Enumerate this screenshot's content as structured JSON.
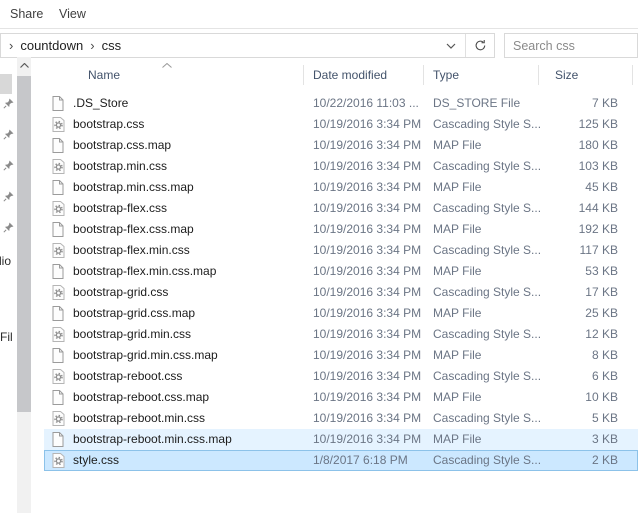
{
  "ribbon": {
    "tabs": [
      {
        "label": "Share"
      },
      {
        "label": "View"
      }
    ]
  },
  "address_bar": {
    "breadcrumb": {
      "separator": "›",
      "items": [
        "countdown",
        "css"
      ]
    },
    "icons": [
      "chevron-down-icon",
      "refresh-icon"
    ]
  },
  "search": {
    "placeholder": "Search css"
  },
  "nav_pane": {
    "pin_icon": "pin-icon",
    "pin_count": 5,
    "clipped_labels": [
      "dio",
      "Fil"
    ]
  },
  "file_list": {
    "columns": [
      {
        "label": "Name",
        "sort": "asc"
      },
      {
        "label": "Date modified"
      },
      {
        "label": "Type"
      },
      {
        "label": "Size"
      }
    ],
    "rows": [
      {
        "name": ".DS_Store",
        "date": "10/22/2016 11:03 ...",
        "type": "DS_STORE File",
        "size": "7 KB",
        "icon": "file",
        "state": "none"
      },
      {
        "name": "bootstrap.css",
        "date": "10/19/2016 3:34 PM",
        "type": "Cascading Style S...",
        "size": "125 KB",
        "icon": "css",
        "state": "none"
      },
      {
        "name": "bootstrap.css.map",
        "date": "10/19/2016 3:34 PM",
        "type": "MAP File",
        "size": "180 KB",
        "icon": "file",
        "state": "none"
      },
      {
        "name": "bootstrap.min.css",
        "date": "10/19/2016 3:34 PM",
        "type": "Cascading Style S...",
        "size": "103 KB",
        "icon": "css",
        "state": "none"
      },
      {
        "name": "bootstrap.min.css.map",
        "date": "10/19/2016 3:34 PM",
        "type": "MAP File",
        "size": "45 KB",
        "icon": "file",
        "state": "none"
      },
      {
        "name": "bootstrap-flex.css",
        "date": "10/19/2016 3:34 PM",
        "type": "Cascading Style S...",
        "size": "144 KB",
        "icon": "css",
        "state": "none"
      },
      {
        "name": "bootstrap-flex.css.map",
        "date": "10/19/2016 3:34 PM",
        "type": "MAP File",
        "size": "192 KB",
        "icon": "file",
        "state": "none"
      },
      {
        "name": "bootstrap-flex.min.css",
        "date": "10/19/2016 3:34 PM",
        "type": "Cascading Style S...",
        "size": "117 KB",
        "icon": "css",
        "state": "none"
      },
      {
        "name": "bootstrap-flex.min.css.map",
        "date": "10/19/2016 3:34 PM",
        "type": "MAP File",
        "size": "53 KB",
        "icon": "file",
        "state": "none"
      },
      {
        "name": "bootstrap-grid.css",
        "date": "10/19/2016 3:34 PM",
        "type": "Cascading Style S...",
        "size": "17 KB",
        "icon": "css",
        "state": "none"
      },
      {
        "name": "bootstrap-grid.css.map",
        "date": "10/19/2016 3:34 PM",
        "type": "MAP File",
        "size": "25 KB",
        "icon": "file",
        "state": "none"
      },
      {
        "name": "bootstrap-grid.min.css",
        "date": "10/19/2016 3:34 PM",
        "type": "Cascading Style S...",
        "size": "12 KB",
        "icon": "css",
        "state": "none"
      },
      {
        "name": "bootstrap-grid.min.css.map",
        "date": "10/19/2016 3:34 PM",
        "type": "MAP File",
        "size": "8 KB",
        "icon": "file",
        "state": "none"
      },
      {
        "name": "bootstrap-reboot.css",
        "date": "10/19/2016 3:34 PM",
        "type": "Cascading Style S...",
        "size": "6 KB",
        "icon": "css",
        "state": "none"
      },
      {
        "name": "bootstrap-reboot.css.map",
        "date": "10/19/2016 3:34 PM",
        "type": "MAP File",
        "size": "10 KB",
        "icon": "file",
        "state": "none"
      },
      {
        "name": "bootstrap-reboot.min.css",
        "date": "10/19/2016 3:34 PM",
        "type": "Cascading Style S...",
        "size": "5 KB",
        "icon": "css",
        "state": "none"
      },
      {
        "name": "bootstrap-reboot.min.css.map",
        "date": "10/19/2016 3:34 PM",
        "type": "MAP File",
        "size": "3 KB",
        "icon": "file",
        "state": "hover"
      },
      {
        "name": "style.css",
        "date": "1/8/2017 6:18 PM",
        "type": "Cascading Style S...",
        "size": "2 KB",
        "icon": "css",
        "state": "selected"
      }
    ]
  },
  "colors": {
    "selection_bg": "#cce8ff",
    "selection_border": "#8cc2e9",
    "hover_bg": "#e5f3ff",
    "header_text": "#43536b",
    "secondary_text": "#6b7585"
  }
}
